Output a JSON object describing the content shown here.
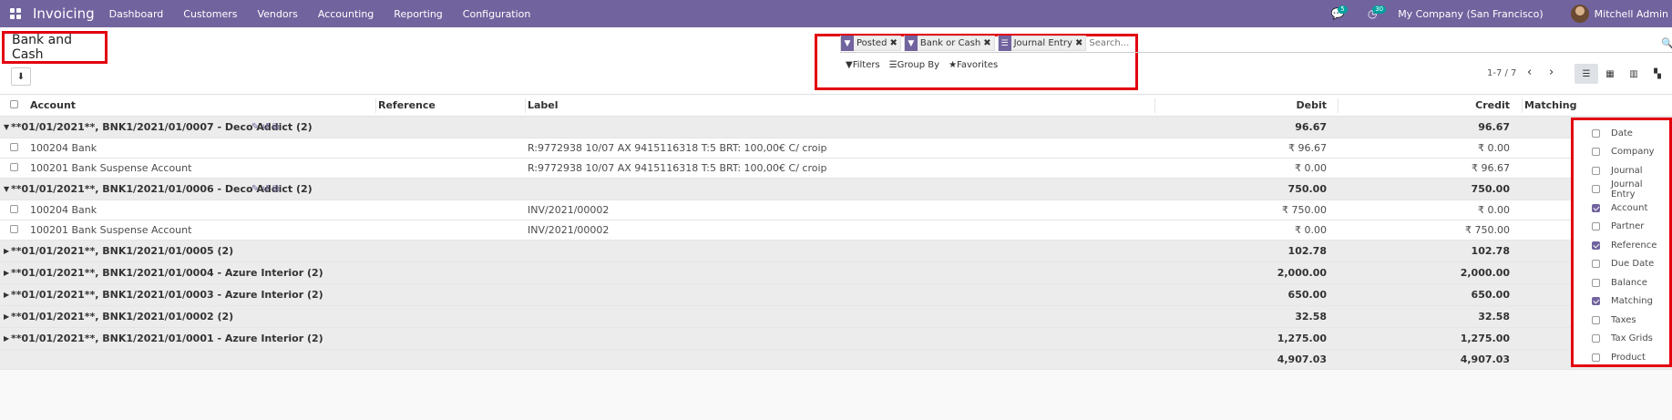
{
  "navbar": {
    "app_name": "Invoicing",
    "menu": [
      "Dashboard",
      "Customers",
      "Vendors",
      "Accounting",
      "Reporting",
      "Configuration"
    ],
    "messages_count": "5",
    "activities_count": "30",
    "company": "My Company (San Francisco)",
    "user": "Mitchell Admin"
  },
  "control": {
    "title": "Bank and Cash",
    "facets": [
      {
        "icon": "filter-icon",
        "label": "Posted"
      },
      {
        "icon": "filter-icon",
        "label": "Bank or Cash"
      },
      {
        "icon": "groupby-icon",
        "label": "Journal Entry"
      }
    ],
    "search_placeholder": "Search...",
    "filters_label": "Filters",
    "groupby_label": "Group By",
    "favorites_label": "Favorites",
    "pager": "1-7 / 7"
  },
  "table": {
    "headers": {
      "account": "Account",
      "reference": "Reference",
      "label": "Label",
      "debit": "Debit",
      "credit": "Credit",
      "matching": "Matching"
    },
    "rows": [
      {
        "type": "group",
        "open": true,
        "title": "**01/01/2021**, BNK1/2021/01/0007 - Deco Addict (2)",
        "icons": true,
        "debit": "96.67",
        "credit": "96.67"
      },
      {
        "type": "data",
        "account": "100204 Bank",
        "label": "R:9772938 10/07 AX 9415116318 T:5 BRT: 100,00€ C/ croip",
        "debit": "₹ 96.67",
        "credit": "₹ 0.00"
      },
      {
        "type": "data",
        "account": "100201 Bank Suspense Account",
        "label": "R:9772938 10/07 AX 9415116318 T:5 BRT: 100,00€ C/ croip",
        "debit": "₹ 0.00",
        "credit": "₹ 96.67"
      },
      {
        "type": "group",
        "open": true,
        "title": "**01/01/2021**, BNK1/2021/01/0006 - Deco Addict (2)",
        "icons": true,
        "debit": "750.00",
        "credit": "750.00"
      },
      {
        "type": "data",
        "account": "100204 Bank",
        "label": "INV/2021/00002",
        "debit": "₹ 750.00",
        "credit": "₹ 0.00"
      },
      {
        "type": "data",
        "account": "100201 Bank Suspense Account",
        "label": "INV/2021/00002",
        "debit": "₹ 0.00",
        "credit": "₹ 750.00"
      },
      {
        "type": "group",
        "open": false,
        "title": "**01/01/2021**, BNK1/2021/01/0005 (2)",
        "icons": false,
        "debit": "102.78",
        "credit": "102.78"
      },
      {
        "type": "group",
        "open": false,
        "title": "**01/01/2021**, BNK1/2021/01/0004 - Azure Interior (2)",
        "icons": false,
        "debit": "2,000.00",
        "credit": "2,000.00"
      },
      {
        "type": "group",
        "open": false,
        "title": "**01/01/2021**, BNK1/2021/01/0003 - Azure Interior (2)",
        "icons": false,
        "debit": "650.00",
        "credit": "650.00"
      },
      {
        "type": "group",
        "open": false,
        "title": "**01/01/2021**, BNK1/2021/01/0002 (2)",
        "icons": false,
        "debit": "32.58",
        "credit": "32.58"
      },
      {
        "type": "group",
        "open": false,
        "title": "**01/01/2021**, BNK1/2021/01/0001 - Azure Interior (2)",
        "icons": false,
        "debit": "1,275.00",
        "credit": "1,275.00"
      }
    ],
    "total": {
      "debit": "4,907.03",
      "credit": "4,907.03"
    }
  },
  "column_options": [
    {
      "label": "Date",
      "checked": false
    },
    {
      "label": "Company",
      "checked": false
    },
    {
      "label": "Journal",
      "checked": false
    },
    {
      "label": "Journal Entry",
      "checked": false
    },
    {
      "label": "Account",
      "checked": true
    },
    {
      "label": "Partner",
      "checked": false
    },
    {
      "label": "Reference",
      "checked": true
    },
    {
      "label": "Due Date",
      "checked": false
    },
    {
      "label": "Balance",
      "checked": false
    },
    {
      "label": "Matching",
      "checked": true
    },
    {
      "label": "Taxes",
      "checked": false
    },
    {
      "label": "Tax Grids",
      "checked": false
    },
    {
      "label": "Product",
      "checked": false
    }
  ],
  "colors": {
    "brand": "#71639e",
    "highlight": "#e3000f",
    "badge": "#00a09d"
  }
}
